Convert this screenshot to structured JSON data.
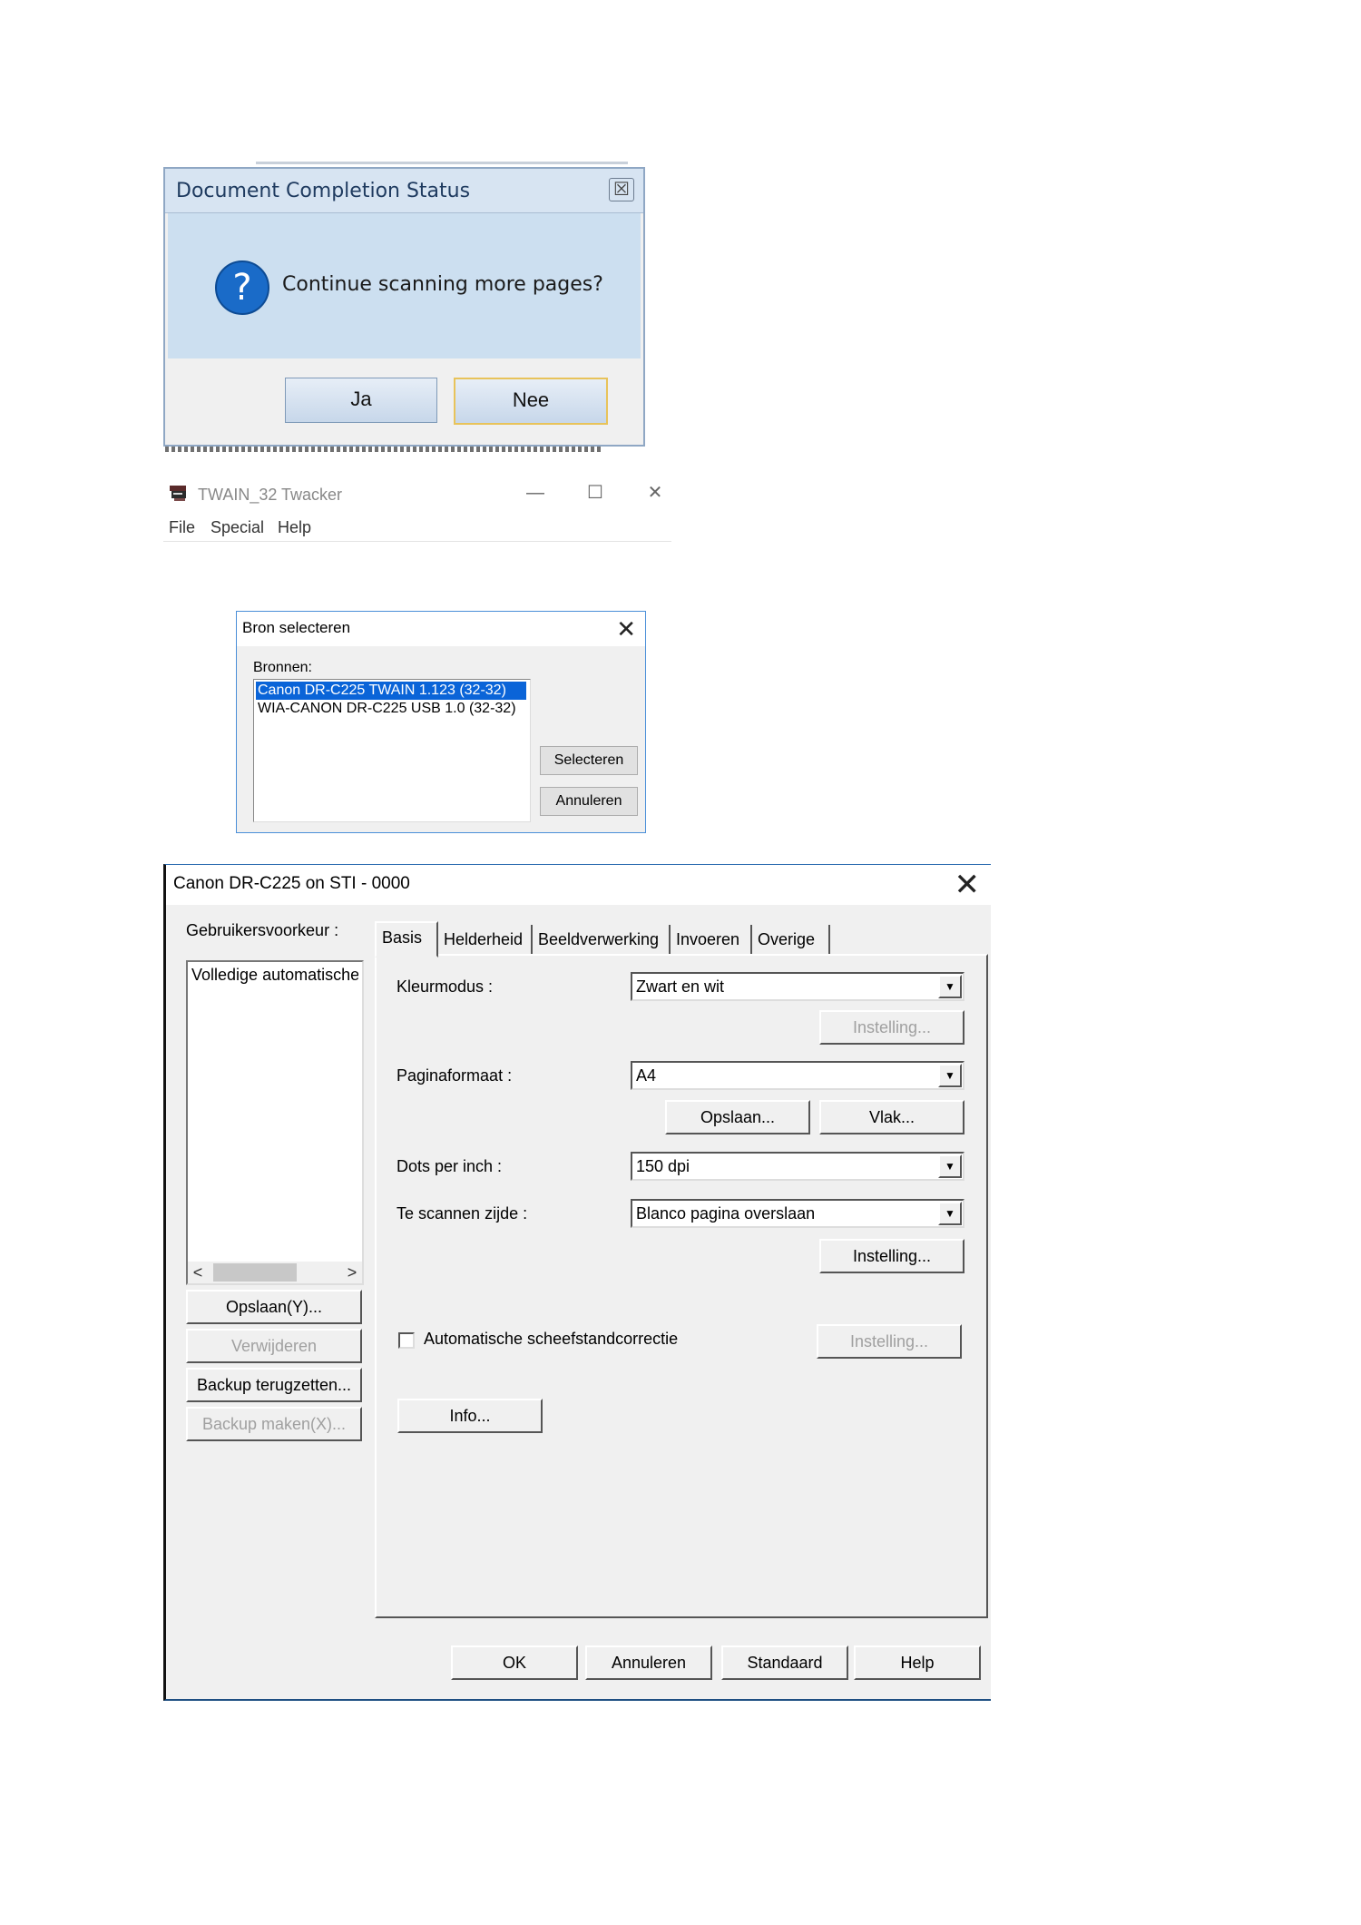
{
  "completion_dialog": {
    "title": "Document Completion Status",
    "close_glyph": "☒",
    "question_glyph": "?",
    "message": "Continue scanning more pages?",
    "yes_label": "Ja",
    "no_label": "Nee"
  },
  "twacker": {
    "title": "TWAIN_32 Twacker",
    "minimize_glyph": "—",
    "maximize_glyph": "☐",
    "close_glyph": "✕",
    "menu": [
      "File",
      "Special",
      "Help"
    ]
  },
  "source_dialog": {
    "title": "Bron selecteren",
    "close_glyph": "✕",
    "sources_label": "Bronnen:",
    "sources": [
      "Canon DR-C225 TWAIN 1.123 (32-32)",
      "WIA-CANON DR-C225 USB 1.0 (32-32)"
    ],
    "select_label": "Selecteren",
    "cancel_label": "Annuleren"
  },
  "canon_dialog": {
    "title": "Canon DR-C225 on STI - 0000",
    "close_glyph": "✕",
    "user_pref_label": "Gebruikersvoorkeur :",
    "user_pref_item": "Volledige automatische",
    "scroll_left": "<",
    "scroll_right": ">",
    "left_buttons": {
      "save": "Opslaan(Y)...",
      "delete": "Verwijderen",
      "restore": "Backup terugzetten...",
      "backup": "Backup maken(X)..."
    },
    "tabs": [
      "Basis",
      "Helderheid",
      "Beeldverwerking",
      "Invoeren",
      "Overige"
    ],
    "color_mode_label": "Kleurmodus :",
    "color_mode_value": "Zwart en wit",
    "color_settings": "Instelling...",
    "page_size_label": "Paginaformaat :",
    "page_size_value": "A4",
    "save_button": "Opslaan...",
    "area_button": "Vlak...",
    "dpi_label": "Dots per inch :",
    "dpi_value": "150 dpi",
    "side_label": "Te scannen zijde :",
    "side_value": "Blanco pagina overslaan",
    "side_settings": "Instelling...",
    "deskew_label": "Automatische scheefstandcorrectie",
    "deskew_settings": "Instelling...",
    "info_button": "Info...",
    "ok": "OK",
    "cancel": "Annuleren",
    "default": "Standaard",
    "help": "Help",
    "dropdown_glyph": "▼"
  }
}
